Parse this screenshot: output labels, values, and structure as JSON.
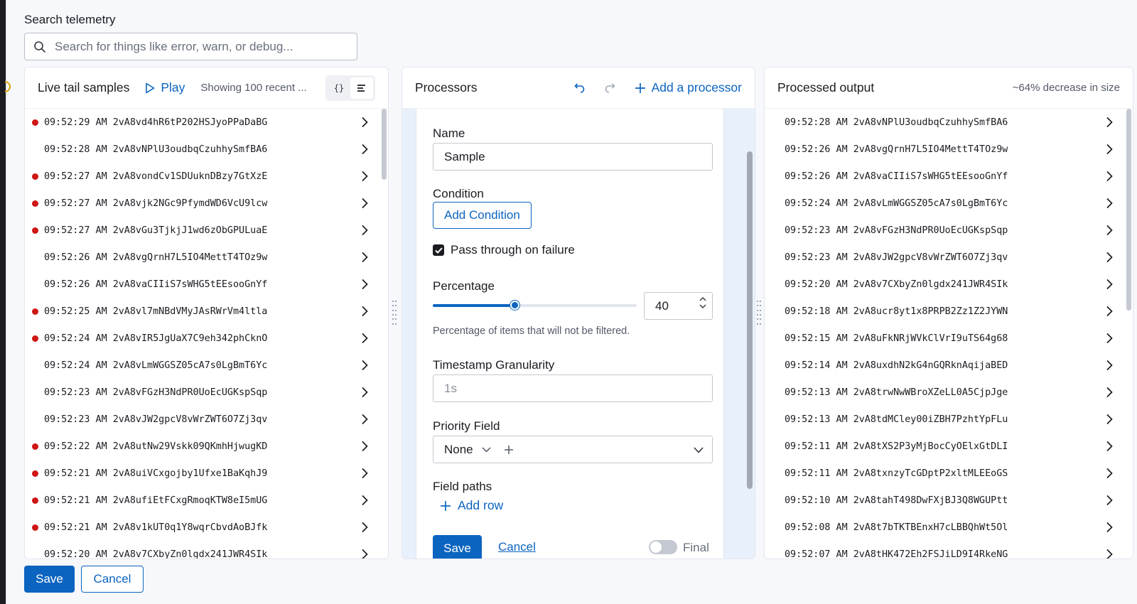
{
  "search": {
    "label": "Search telemetry",
    "placeholder": "Search for things like error, warn, or debug..."
  },
  "live_tail": {
    "title": "Live tail samples",
    "play_label": "Play",
    "showing_text": "Showing 100 recent ...",
    "json_view_icon": "{}",
    "rows": [
      {
        "time": "09:52:29 AM",
        "id": "2vA8vd4hR6tP202HSJyoPPaDaBG",
        "error": true
      },
      {
        "time": "09:52:28 AM",
        "id": "2vA8vNPlU3oudbqCzuhhySmfBA6",
        "error": false
      },
      {
        "time": "09:52:27 AM",
        "id": "2vA8vondCv1SDUuknDBzy7GtXzE",
        "error": true
      },
      {
        "time": "09:52:27 AM",
        "id": "2vA8vjk2NGc9PfymdWD6VcU9lcw",
        "error": true
      },
      {
        "time": "09:52:27 AM",
        "id": "2vA8vGu3TjkjJ1wd6zObGPULuaE",
        "error": true
      },
      {
        "time": "09:52:26 AM",
        "id": "2vA8vgQrnH7L5IO4MettT4TOz9w",
        "error": false
      },
      {
        "time": "09:52:26 AM",
        "id": "2vA8vaCIIiS7sWHG5tEEsooGnYf",
        "error": false
      },
      {
        "time": "09:52:25 AM",
        "id": "2vA8vl7mNBdVMyJAsRWrVm4ltla",
        "error": true
      },
      {
        "time": "09:52:24 AM",
        "id": "2vA8vIR5JgUaX7C9eh342phCknO",
        "error": true
      },
      {
        "time": "09:52:24 AM",
        "id": "2vA8vLmWGGSZ05cA7s0LgBmT6Yc",
        "error": false
      },
      {
        "time": "09:52:23 AM",
        "id": "2vA8vFGzH3NdPR0UoEcUGKspSqp",
        "error": false
      },
      {
        "time": "09:52:23 AM",
        "id": "2vA8vJW2gpcV8vWrZWT6O7Zj3qv",
        "error": false
      },
      {
        "time": "09:52:22 AM",
        "id": "2vA8utNw29Vskk09QKmhHjwugKD",
        "error": true
      },
      {
        "time": "09:52:21 AM",
        "id": "2vA8uiVCxgojby1Ufxe1BaKqhJ9",
        "error": true
      },
      {
        "time": "09:52:21 AM",
        "id": "2vA8ufiEtFCxgRmoqKTW8eI5mUG",
        "error": true
      },
      {
        "time": "09:52:21 AM",
        "id": "2vA8v1kUT0q1Y8wqrCbvdAoBJfk",
        "error": true
      },
      {
        "time": "09:52:20 AM",
        "id": "2vA8v7CXbyZn0lgdx241JWR4SIk",
        "error": false
      }
    ]
  },
  "processors": {
    "title": "Processors",
    "add_label": "Add a processor",
    "form": {
      "name_label": "Name",
      "name_value": "Sample",
      "condition_label": "Condition",
      "add_condition_label": "Add Condition",
      "pass_through_label": "Pass through on failure",
      "pass_through_checked": true,
      "percentage_label": "Percentage",
      "percentage_value": "40",
      "percentage_fraction": 0.4,
      "percentage_help": "Percentage of items that will not be filtered.",
      "granularity_label": "Timestamp Granularity",
      "granularity_placeholder": "1s",
      "priority_label": "Priority Field",
      "priority_value": "None",
      "field_paths_label": "Field paths",
      "add_row_label": "Add row",
      "save_label": "Save",
      "cancel_label": "Cancel",
      "final_label": "Final"
    }
  },
  "output": {
    "title": "Processed output",
    "size_note": "~64% decrease in size",
    "rows": [
      {
        "time": "09:52:28 AM",
        "id": "2vA8vNPlU3oudbqCzuhhySmfBA6"
      },
      {
        "time": "09:52:26 AM",
        "id": "2vA8vgQrnH7L5IO4MettT4TOz9w"
      },
      {
        "time": "09:52:26 AM",
        "id": "2vA8vaCIIiS7sWHG5tEEsooGnYf"
      },
      {
        "time": "09:52:24 AM",
        "id": "2vA8vLmWGGSZ05cA7s0LgBmT6Yc"
      },
      {
        "time": "09:52:23 AM",
        "id": "2vA8vFGzH3NdPR0UoEcUGKspSqp"
      },
      {
        "time": "09:52:23 AM",
        "id": "2vA8vJW2gpcV8vWrZWT6O7Zj3qv"
      },
      {
        "time": "09:52:20 AM",
        "id": "2vA8v7CXbyZn0lgdx241JWR4SIk"
      },
      {
        "time": "09:52:18 AM",
        "id": "2vA8ucr8yt1x8PRPB2Zz1Z2JYWN"
      },
      {
        "time": "09:52:15 AM",
        "id": "2vA8uFkNRjWVkClVrI9uTS64g68"
      },
      {
        "time": "09:52:14 AM",
        "id": "2vA8uxdhN2kG4nGQRknAqijaBED"
      },
      {
        "time": "09:52:13 AM",
        "id": "2vA8trwNwWBroXZeLL0A5CjpJge"
      },
      {
        "time": "09:52:13 AM",
        "id": "2vA8tdMCley00iZBH7PzhtYpFLu"
      },
      {
        "time": "09:52:11 AM",
        "id": "2vA8tXS2P3yMjBocCyOElxGtDLI"
      },
      {
        "time": "09:52:11 AM",
        "id": "2vA8txnzyTcGDptP2xltMLEEoGS"
      },
      {
        "time": "09:52:10 AM",
        "id": "2vA8tahT498DwFXjBJ3Q8WGUPtt"
      },
      {
        "time": "09:52:08 AM",
        "id": "2vA8t7bTKTBEnxH7cLBBQhWt5Ol"
      },
      {
        "time": "09:52:07 AM",
        "id": "2vA8tHK472Eh2FSJiLD9I4RkeNG"
      }
    ]
  },
  "footer": {
    "save_label": "Save",
    "cancel_label": "Cancel"
  },
  "colors": {
    "accent": "#0b64c0",
    "error_dot": "#cf1515",
    "window_bg": "#f7f8fc"
  }
}
